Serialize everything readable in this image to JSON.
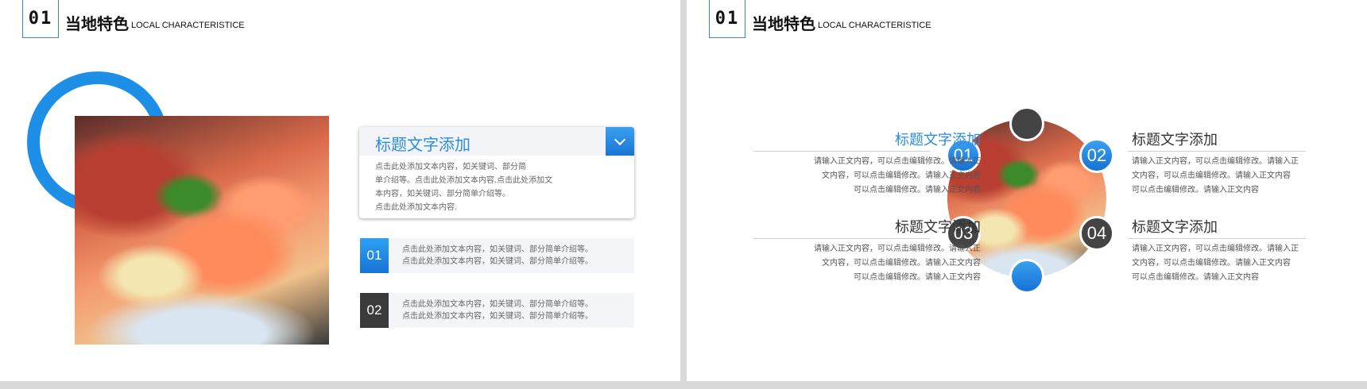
{
  "header": {
    "number": "01",
    "title": "当地特色",
    "subtitle": "LOCAL CHARACTERISTICE"
  },
  "left_slide": {
    "card": {
      "title": "标题文字添加",
      "lines": [
        "点击此处添加文本内容，如关键词、部分简",
        "单介绍等。点击此处添加文本内容.点击此处添加文",
        "本内容，如关键词、部分简单介绍等。",
        "点击此处添加文本内容."
      ]
    },
    "items": [
      {
        "number": "01",
        "lines": [
          "点击此处添加文本内容，如关键词、部分简单介绍等。",
          "点击此处添加文本内容，如关键词、部分简单介绍等。"
        ]
      },
      {
        "number": "02",
        "lines": [
          "点击此处添加文本内容，如关键词、部分简单介绍等。",
          "点击此处添加文本内容，如关键词、部分简单介绍等。"
        ]
      }
    ]
  },
  "right_slide": {
    "badges": [
      "01",
      "02",
      "03",
      "04"
    ],
    "blocks": [
      {
        "title": "标题文字添加",
        "lines": [
          "请输入正文内容，可以点击编辑修改。请输入正",
          "文内容，可以点击编辑修改。请输入正文内容",
          "可以点击编辑修改。请输入正文内容"
        ]
      },
      {
        "title": "标题文字添加",
        "lines": [
          "请输入正文内容，可以点击编辑修改。请输入正",
          "文内容，可以点击编辑修改。请输入正文内容",
          "可以点击编辑修改。请输入正文内容"
        ]
      },
      {
        "title": "标题文字添加",
        "lines": [
          "请输入正文内容，可以点击编辑修改。请输入正",
          "文内容，可以点击编辑修改。请输入正文内容",
          "可以点击编辑修改。请输入正文内容"
        ]
      },
      {
        "title": "标题文字添加",
        "lines": [
          "请输入正文内容，可以点击编辑修改。请输入正",
          "文内容，可以点击编辑修改。请输入正文内容",
          "可以点击编辑修改。请输入正文内容"
        ]
      }
    ]
  },
  "colors": {
    "accent": "#1e8fe6",
    "dark": "#3b3b3b",
    "title_blue": "#2a8de0",
    "title_dark": "#333333"
  }
}
